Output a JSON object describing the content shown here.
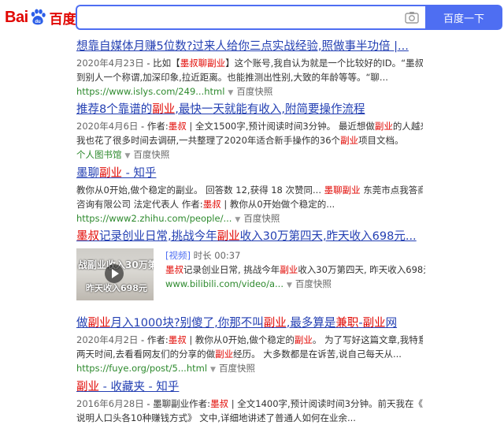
{
  "header": {
    "logo_bai": "Bai",
    "logo_du": "du",
    "logo_cn": "百度",
    "search_value": "",
    "search_button": "百度一下",
    "brand_color": "#e10601",
    "accent_color": "#4e6ef2",
    "camera_icon": "camera-icon"
  },
  "results": [
    {
      "title": "想靠自媒体月赚5位数?过来人给你三点实战经验,照做事半功倍 |...",
      "date": "2020年4月23日",
      "snippet_1a": " - 比如【",
      "snippet_1b": "墨叔聊副业",
      "snippet_1c": "】这个账号,我自认为就是一个比较好的ID。“墨叔”可以给",
      "snippet_2": "到别人一个称谓,加深印象,拉近距离。也能推测出性别,大致的年龄等等。“聊...",
      "url": "https://www.islys.com/249...html",
      "snapshot": "百度快照"
    },
    {
      "title_a": "推荐8个靠谱的",
      "title_b": "副业",
      "title_c": ",最快一天就能有收入,附简要操作流程",
      "date": "2020年4月6日",
      "snippet_1a": " - 作者:",
      "snippet_1b": "墨叔",
      "snippet_1c": " | 全文1500字,预计阅读时间3分钟。 最近想做",
      "snippet_1d": "副业",
      "snippet_1e": "的人越来越多,",
      "snippet_2a": "我也花了很多时间去调研,一共整理了2020年适合新手操作的36个",
      "snippet_2b": "副业",
      "snippet_2c": "项目文档。",
      "url": "个人图书馆",
      "snapshot": "百度快照"
    },
    {
      "title_a": "墨聊",
      "title_b": "副业",
      "title_c": " - 知乎",
      "snippet_1a": "教你从0开始,做个稳定的副业。 回答数 12,获得 18 次赞同... ",
      "snippet_1b": "墨聊副业",
      "snippet_1c": " 东莞市点我答商务信息",
      "snippet_2a": "咨询有限公司 法定代表人 作者:",
      "snippet_2b": "墨叔",
      "snippet_2c": " | 教你从0开始做个稳定的...",
      "url": "https://www2.zhihu.com/people/...",
      "snapshot": "百度快照"
    },
    {
      "title_a": "墨叔",
      "title_b": "记录创业日常,挑战今年",
      "title_c": "副业",
      "title_d": "收入30万第四天,昨天收入698元...",
      "video_tag": "[视频]",
      "video_duration": "时长 00:37",
      "snippet_a": "墨叔",
      "snippet_b": "记录创业日常, 挑战今年",
      "snippet_c": "副业",
      "snippet_d": "收入30万第四天, 昨天收入698元",
      "thumb_text_1": "战副业收入30万第四",
      "thumb_text_2": "昨天收入698元",
      "play_icon": "play-icon",
      "url": "www.bilibili.com/video/a...",
      "snapshot": "百度快照"
    },
    {
      "title_a": "做",
      "title_b": "副业",
      "title_c": "月入1000块?别傻了,你那不叫",
      "title_d": "副业",
      "title_e": ",最多算是",
      "title_f": "兼职",
      "title_g": "-",
      "title_h": "副业",
      "title_i": "网",
      "date": "2020年4月2日",
      "snippet_1a": " - 作者:",
      "snippet_1b": "墨叔",
      "snippet_1c": " | 教你从0开始,做个稳定的",
      "snippet_1d": "副业",
      "snippet_1e": "。 为了写好这篇文章,我特意花了",
      "snippet_2a": "两天时间,去看看网友们的分享的做",
      "snippet_2b": "副业",
      "snippet_2c": "经历。 大多数都是在诉苦,说自己每天从...",
      "url": "https://fuye.org/post/5...html",
      "snapshot": "百度快照"
    },
    {
      "title_a": "副业",
      "title_b": " - 收藏夹 - 知乎",
      "date": "2016年6月28日",
      "snippet_1a": " - 墨聊副业作者:",
      "snippet_1b": "墨叔",
      "snippet_1c": " | 全文1400字,预计阅读时间3分钟。前天我在《2000字",
      "snippet_2": "说明人口头各10种赚钱方式》  文中,详细地讲述了普通人如何在业余..."
    }
  ]
}
